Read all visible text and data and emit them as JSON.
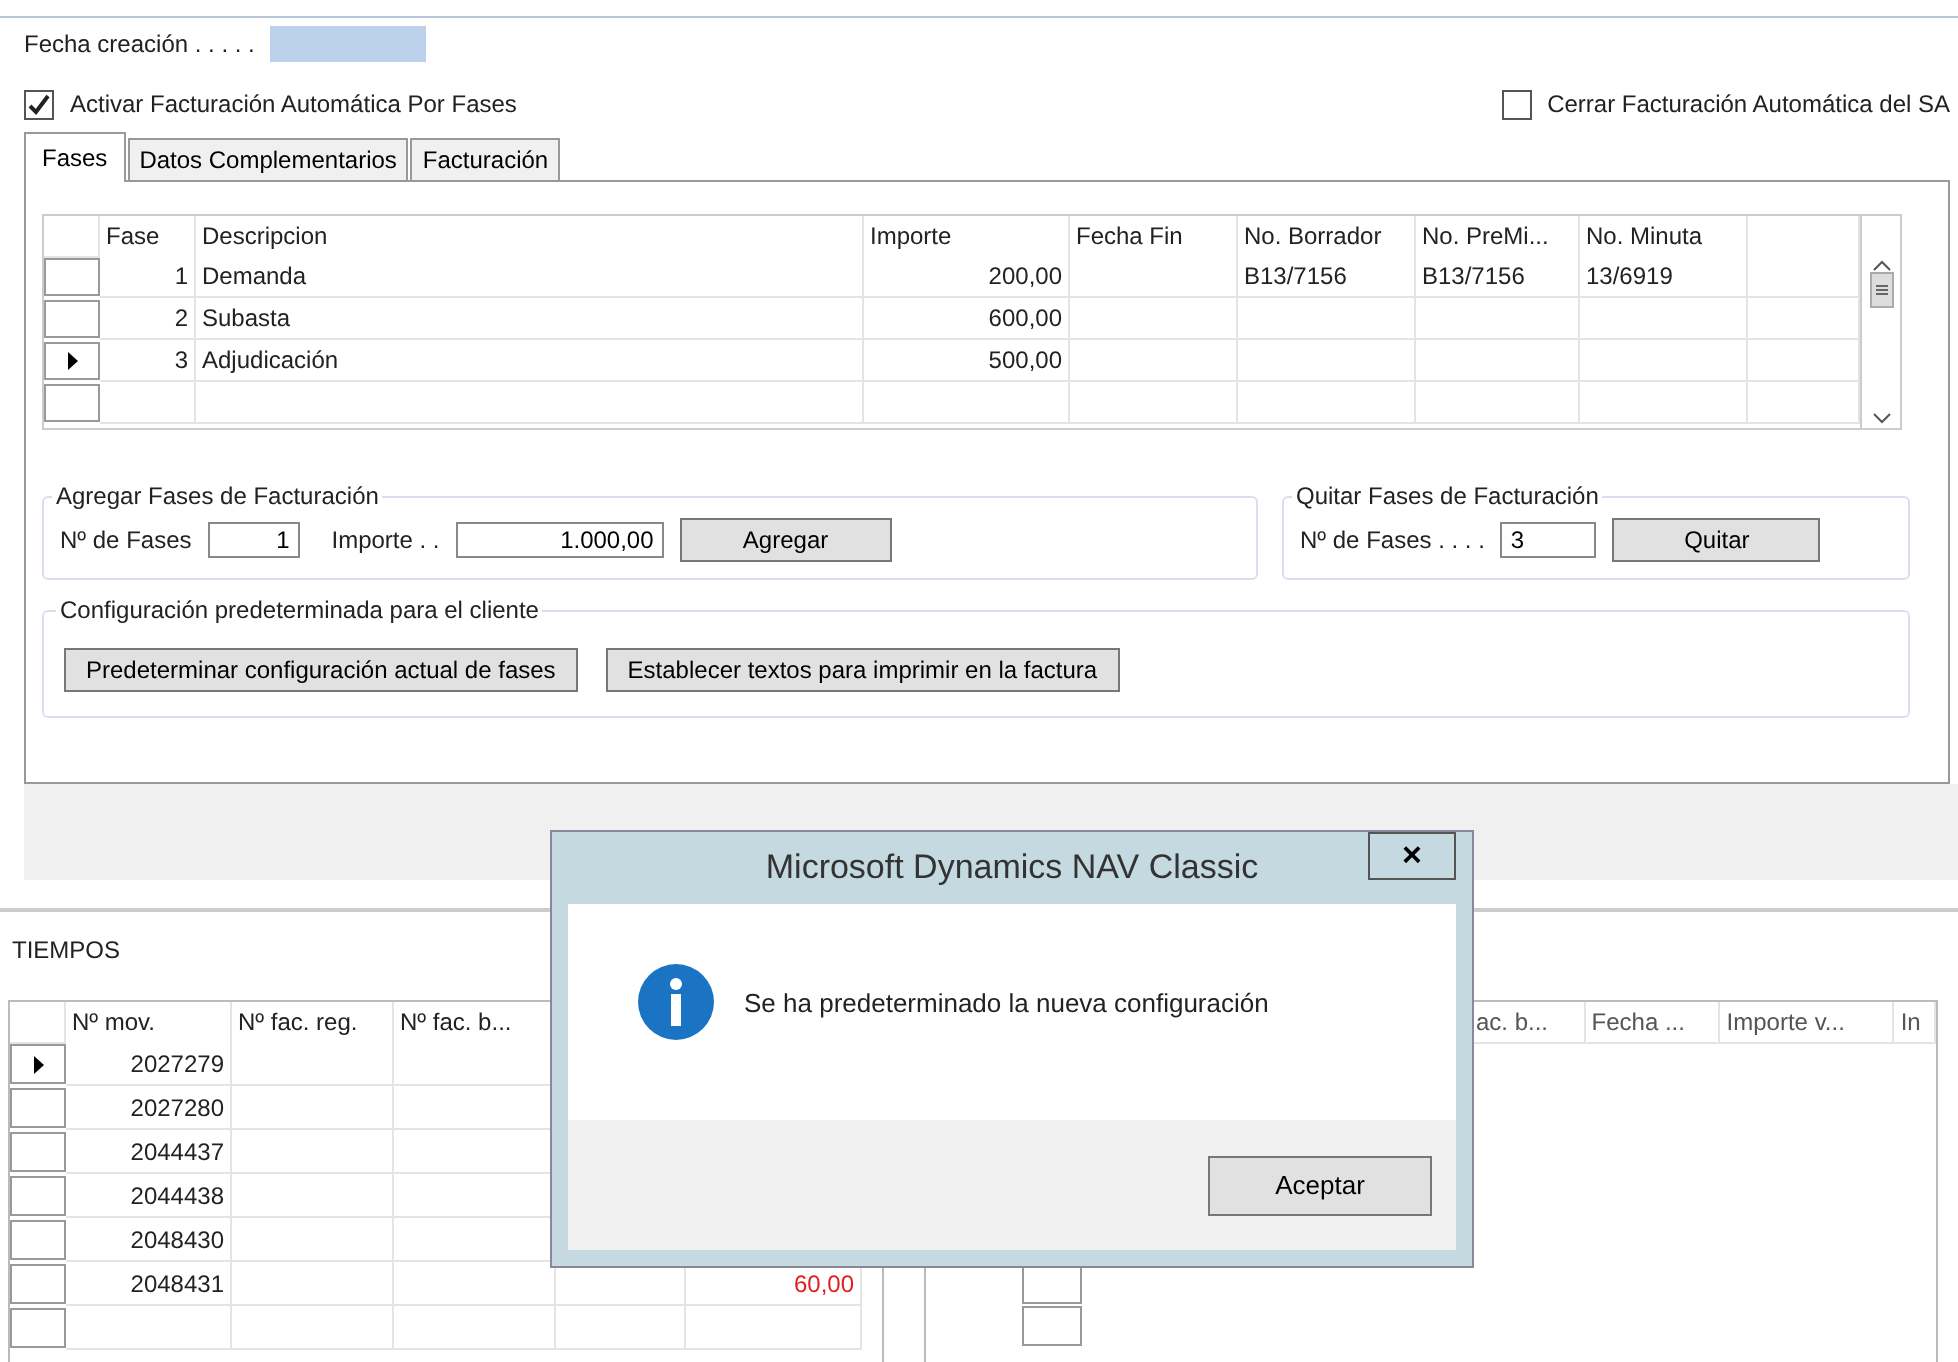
{
  "header": {
    "fecha_label": "Fecha creación . . . . .",
    "activar": {
      "label": "Activar Facturación Automática Por Fases",
      "checked": true
    },
    "cerrar": {
      "label": "Cerrar Facturación Automática del SA",
      "checked": false
    }
  },
  "tabs": [
    {
      "label": "Fases",
      "selected": true
    },
    {
      "label": "Datos Complementarios",
      "selected": false
    },
    {
      "label": "Facturación",
      "selected": false
    }
  ],
  "fases_table": {
    "columns": [
      "Fase",
      "Descripcion",
      "Importe",
      "Fecha Fin",
      "No. Borrador",
      "No. PreMi...",
      "No. Minuta"
    ],
    "rows": [
      {
        "current": false,
        "cells": [
          "1",
          "Demanda",
          "200,00",
          "",
          "B13/7156",
          "B13/7156",
          "13/6919"
        ]
      },
      {
        "current": false,
        "cells": [
          "2",
          "Subasta",
          "600,00",
          "",
          "",
          "",
          ""
        ]
      },
      {
        "current": true,
        "cells": [
          "3",
          "Adjudicación",
          "500,00",
          "",
          "",
          "",
          ""
        ]
      }
    ]
  },
  "agregar": {
    "title": "Agregar Fases de Facturación",
    "fases_label": "Nº de Fases",
    "fases_value": "1",
    "importe_label": "Importe . .",
    "importe_value": "1.000,00",
    "button": "Agregar"
  },
  "quitar": {
    "title": "Quitar Fases de Facturación",
    "fases_label": "Nº de Fases . . . .",
    "fases_value": "3",
    "button": "Quitar"
  },
  "config": {
    "title": "Configuración predeterminada para el cliente",
    "buttons": [
      "Predeterminar configuración actual de fases",
      "Establecer textos para imprimir en la  factura"
    ]
  },
  "tiempos": {
    "title": "TIEMPOS",
    "columns": [
      "Nº mov.",
      "Nº fac. reg.",
      "Nº fac. b..."
    ],
    "rows": [
      {
        "current": true,
        "mov": "2027279",
        "column_5": ""
      },
      {
        "current": false,
        "mov": "2027280",
        "column_5": ""
      },
      {
        "current": false,
        "mov": "2044437",
        "column_5": ""
      },
      {
        "current": false,
        "mov": "2044438",
        "column_5": ""
      },
      {
        "current": false,
        "mov": "2048430",
        "column_5": ""
      },
      {
        "current": false,
        "mov": "2048431",
        "column_5": "60,00"
      }
    ]
  },
  "right_table": {
    "columns": [
      "ac. b...",
      "Fecha ...",
      "Importe v...",
      "In"
    ]
  },
  "dialog": {
    "title": "Microsoft Dynamics NAV Classic",
    "close": "×",
    "message": "Se ha predeterminado la nueva configuración",
    "button": "Aceptar"
  }
}
